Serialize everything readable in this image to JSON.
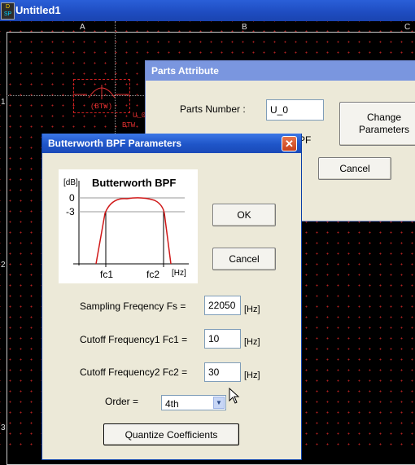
{
  "main_window": {
    "title": "Untitled1",
    "app_icon": {
      "line1": "D",
      "line2": "SP",
      "icon": "dsp-app-icon"
    }
  },
  "schematic": {
    "columns": [
      "A",
      "B",
      "C"
    ],
    "rows": [
      "1",
      "2",
      "3"
    ],
    "component": {
      "ref": "U_0",
      "type": "BTW",
      "symbol_text": "(BTW)"
    },
    "grid_dot_color": "#b02020"
  },
  "parts_attribute": {
    "title": "Parts Attribute",
    "parts_number_label": "Parts Number :",
    "parts_number_value": "U_0",
    "change_parameters_label": "Change\nParameters",
    "cancel_label": "Cancel",
    "partial_text": "PF"
  },
  "bpf_dialog": {
    "title": "Butterworth BPF Parameters",
    "close_icon": "close-x-icon",
    "diagram": {
      "unit_db": "[dB]",
      "heading": "Butterworth BPF",
      "y_ticks": [
        "0",
        "-3"
      ],
      "x_ticks": [
        "fc1",
        "fc2"
      ],
      "unit_hz": "[Hz]"
    },
    "ok_label": "OK",
    "cancel_label": "Cancel",
    "fields": [
      {
        "label": "Sampling Freqency Fs =",
        "value": "22050",
        "unit": "[Hz]"
      },
      {
        "label": "Cutoff Frequency1 Fc1 =",
        "value": "10",
        "unit": "[Hz]"
      },
      {
        "label": "Cutoff Frequency2 Fc2 =",
        "value": "30",
        "unit": "[Hz]"
      }
    ],
    "order": {
      "label": "Order =",
      "value": "4th"
    },
    "quantize_label": "Quantize Coefficients"
  },
  "colors": {
    "titlebar_active": "#1f55c8",
    "titlebar_inactive": "#7a96df",
    "dialog_bg": "#ece9d8",
    "curve": "#d01818"
  }
}
